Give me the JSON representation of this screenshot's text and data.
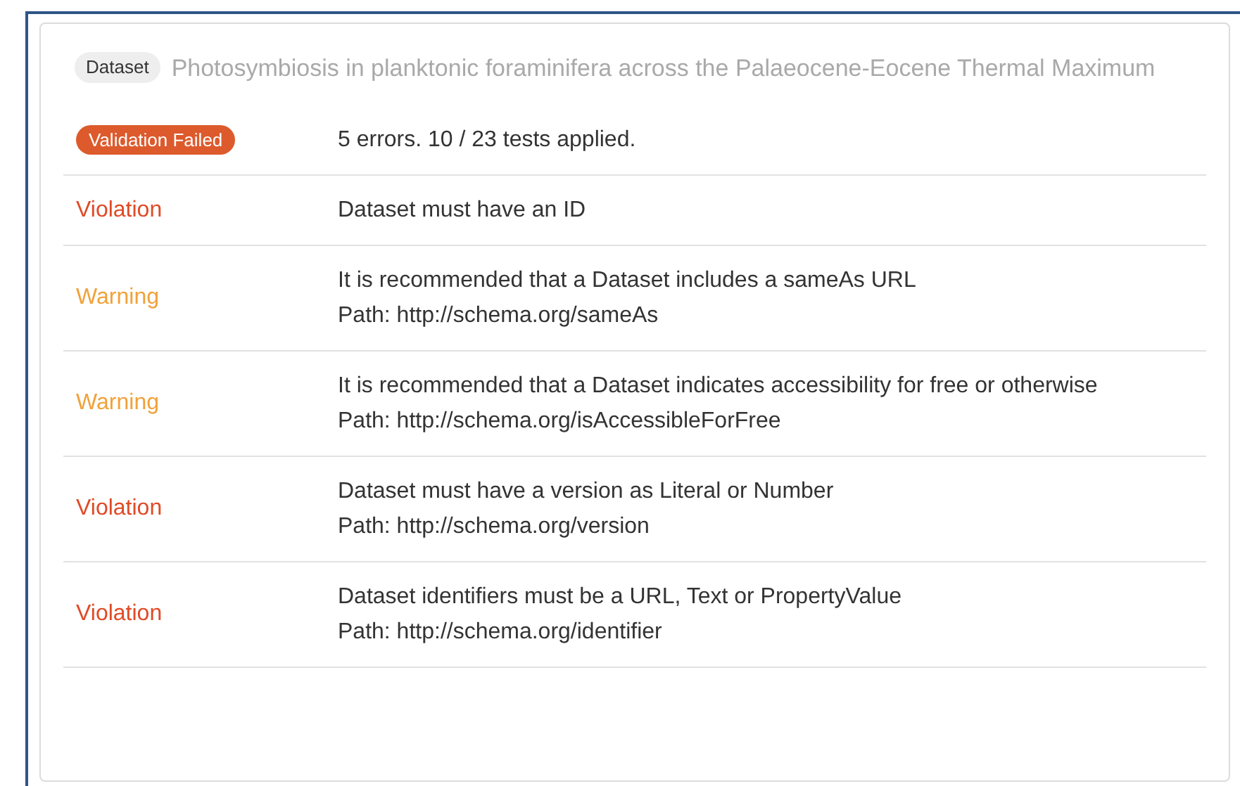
{
  "dataset": {
    "tag": "Dataset",
    "title": "Photosymbiosis in planktonic foraminifera across the Palaeocene-Eocene Thermal Maximum"
  },
  "summary": {
    "badge": "Validation Failed",
    "text": "5 errors. 10 / 23 tests applied."
  },
  "results": [
    {
      "kind": "violation",
      "label": "Violation",
      "lines": [
        "Dataset must have an ID"
      ]
    },
    {
      "kind": "warning",
      "label": "Warning",
      "lines": [
        "It is recommended that a Dataset includes a sameAs URL",
        "Path: http://schema.org/sameAs"
      ]
    },
    {
      "kind": "warning",
      "label": "Warning",
      "lines": [
        "It is recommended that a Dataset indicates accessibility for free or otherwise",
        "Path: http://schema.org/isAccessibleForFree"
      ]
    },
    {
      "kind": "violation",
      "label": "Violation",
      "lines": [
        "Dataset must have a version as Literal or Number",
        "Path: http://schema.org/version"
      ]
    },
    {
      "kind": "violation",
      "label": "Violation",
      "lines": [
        "Dataset identifiers must be a URL, Text or PropertyValue",
        "Path: http://schema.org/identifier"
      ]
    }
  ]
}
